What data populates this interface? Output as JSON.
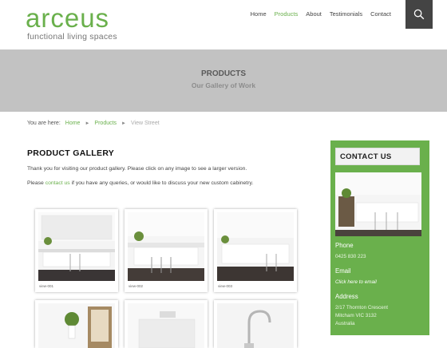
{
  "logo": {
    "word": "arceus",
    "tagline": "functional living spaces"
  },
  "nav": {
    "items": [
      {
        "label": "Home"
      },
      {
        "label": "Products"
      },
      {
        "label": "About"
      },
      {
        "label": "Testimonials"
      },
      {
        "label": "Contact"
      }
    ],
    "active": "Products",
    "search_icon": "search-icon"
  },
  "banner": {
    "title": "PRODUCTS",
    "subtitle": "Our Gallery of Work"
  },
  "breadcrumb": {
    "prefix": "You are here:",
    "home": "Home",
    "products": "Products",
    "current": "View Street"
  },
  "gallery": {
    "title": "PRODUCT GALLERY",
    "intro": "Thank you for visiting our product gallery. Please click on any image to see a larger version.",
    "contact_pre": "Please",
    "contact_link": "contact us",
    "contact_post": "if you have any queries, or would like to discuss your new custom cabinetry.",
    "thumbs": [
      {
        "caption": "view-001"
      },
      {
        "caption": "view-002"
      },
      {
        "caption": "view-003"
      },
      {
        "caption": ""
      },
      {
        "caption": ""
      },
      {
        "caption": ""
      }
    ]
  },
  "sidebar": {
    "heading": "CONTACT US",
    "phone_label": "Phone",
    "phone": "0425 830 223",
    "email_label": "Email",
    "email": "Click here to email",
    "address_label": "Address",
    "address_line1": "2/17 Thornton Crescent",
    "address_line2": "Mitcham VIC 3132",
    "address_line3": "Australia"
  },
  "colors": {
    "accent": "#6ab04c",
    "banner": "#c2c2c2",
    "search_box": "#444444"
  }
}
